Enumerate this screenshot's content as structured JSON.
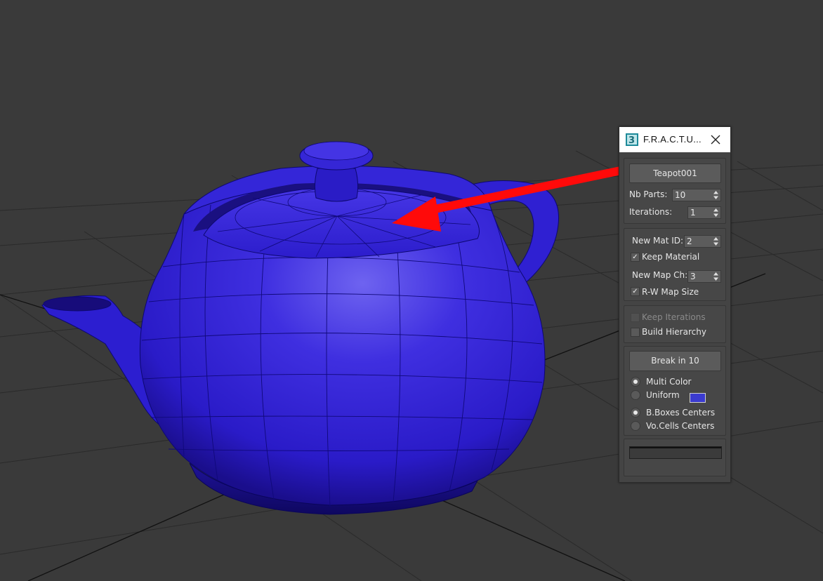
{
  "window": {
    "title": "F.R.A.C.T.U...",
    "icon": "3ds-max-app-icon",
    "close_icon": "close-icon"
  },
  "object_group": {
    "pick_button": "Teapot001",
    "nb_parts_label": "Nb Parts:",
    "nb_parts_value": "10",
    "iterations_label": "Iterations:",
    "iterations_value": "1"
  },
  "material_group": {
    "new_mat_id_label": "New Mat ID:",
    "new_mat_id_value": "2",
    "keep_material_label": "Keep Material",
    "keep_material_checked": true,
    "new_map_ch_label": "New Map Ch:",
    "new_map_ch_value": "3",
    "rw_map_size_label": "R-W Map Size",
    "rw_map_size_checked": true
  },
  "hierarchy_group": {
    "keep_iterations_label": "Keep Iterations",
    "keep_iterations_checked": false,
    "keep_iterations_enabled": false,
    "build_hierarchy_label": "Build Hierarchy",
    "build_hierarchy_checked": false
  },
  "break_group": {
    "break_button": "Break in 10",
    "multi_color_label": "Multi Color",
    "multi_color_selected": true,
    "uniform_label": "Uniform",
    "uniform_selected": false,
    "uniform_color": "#3b3bd0",
    "bbox_centers_label": "B.Boxes Centers",
    "bbox_centers_selected": true,
    "vocells_centers_label": "Vo.Cells Centers",
    "vocells_centers_selected": false
  },
  "progress_group": {
    "progress": 0
  },
  "viewport": {
    "background": "#3a3a3a",
    "object_color": "#2d1fd0",
    "annotation_arrow_color": "#ff0a0a"
  }
}
